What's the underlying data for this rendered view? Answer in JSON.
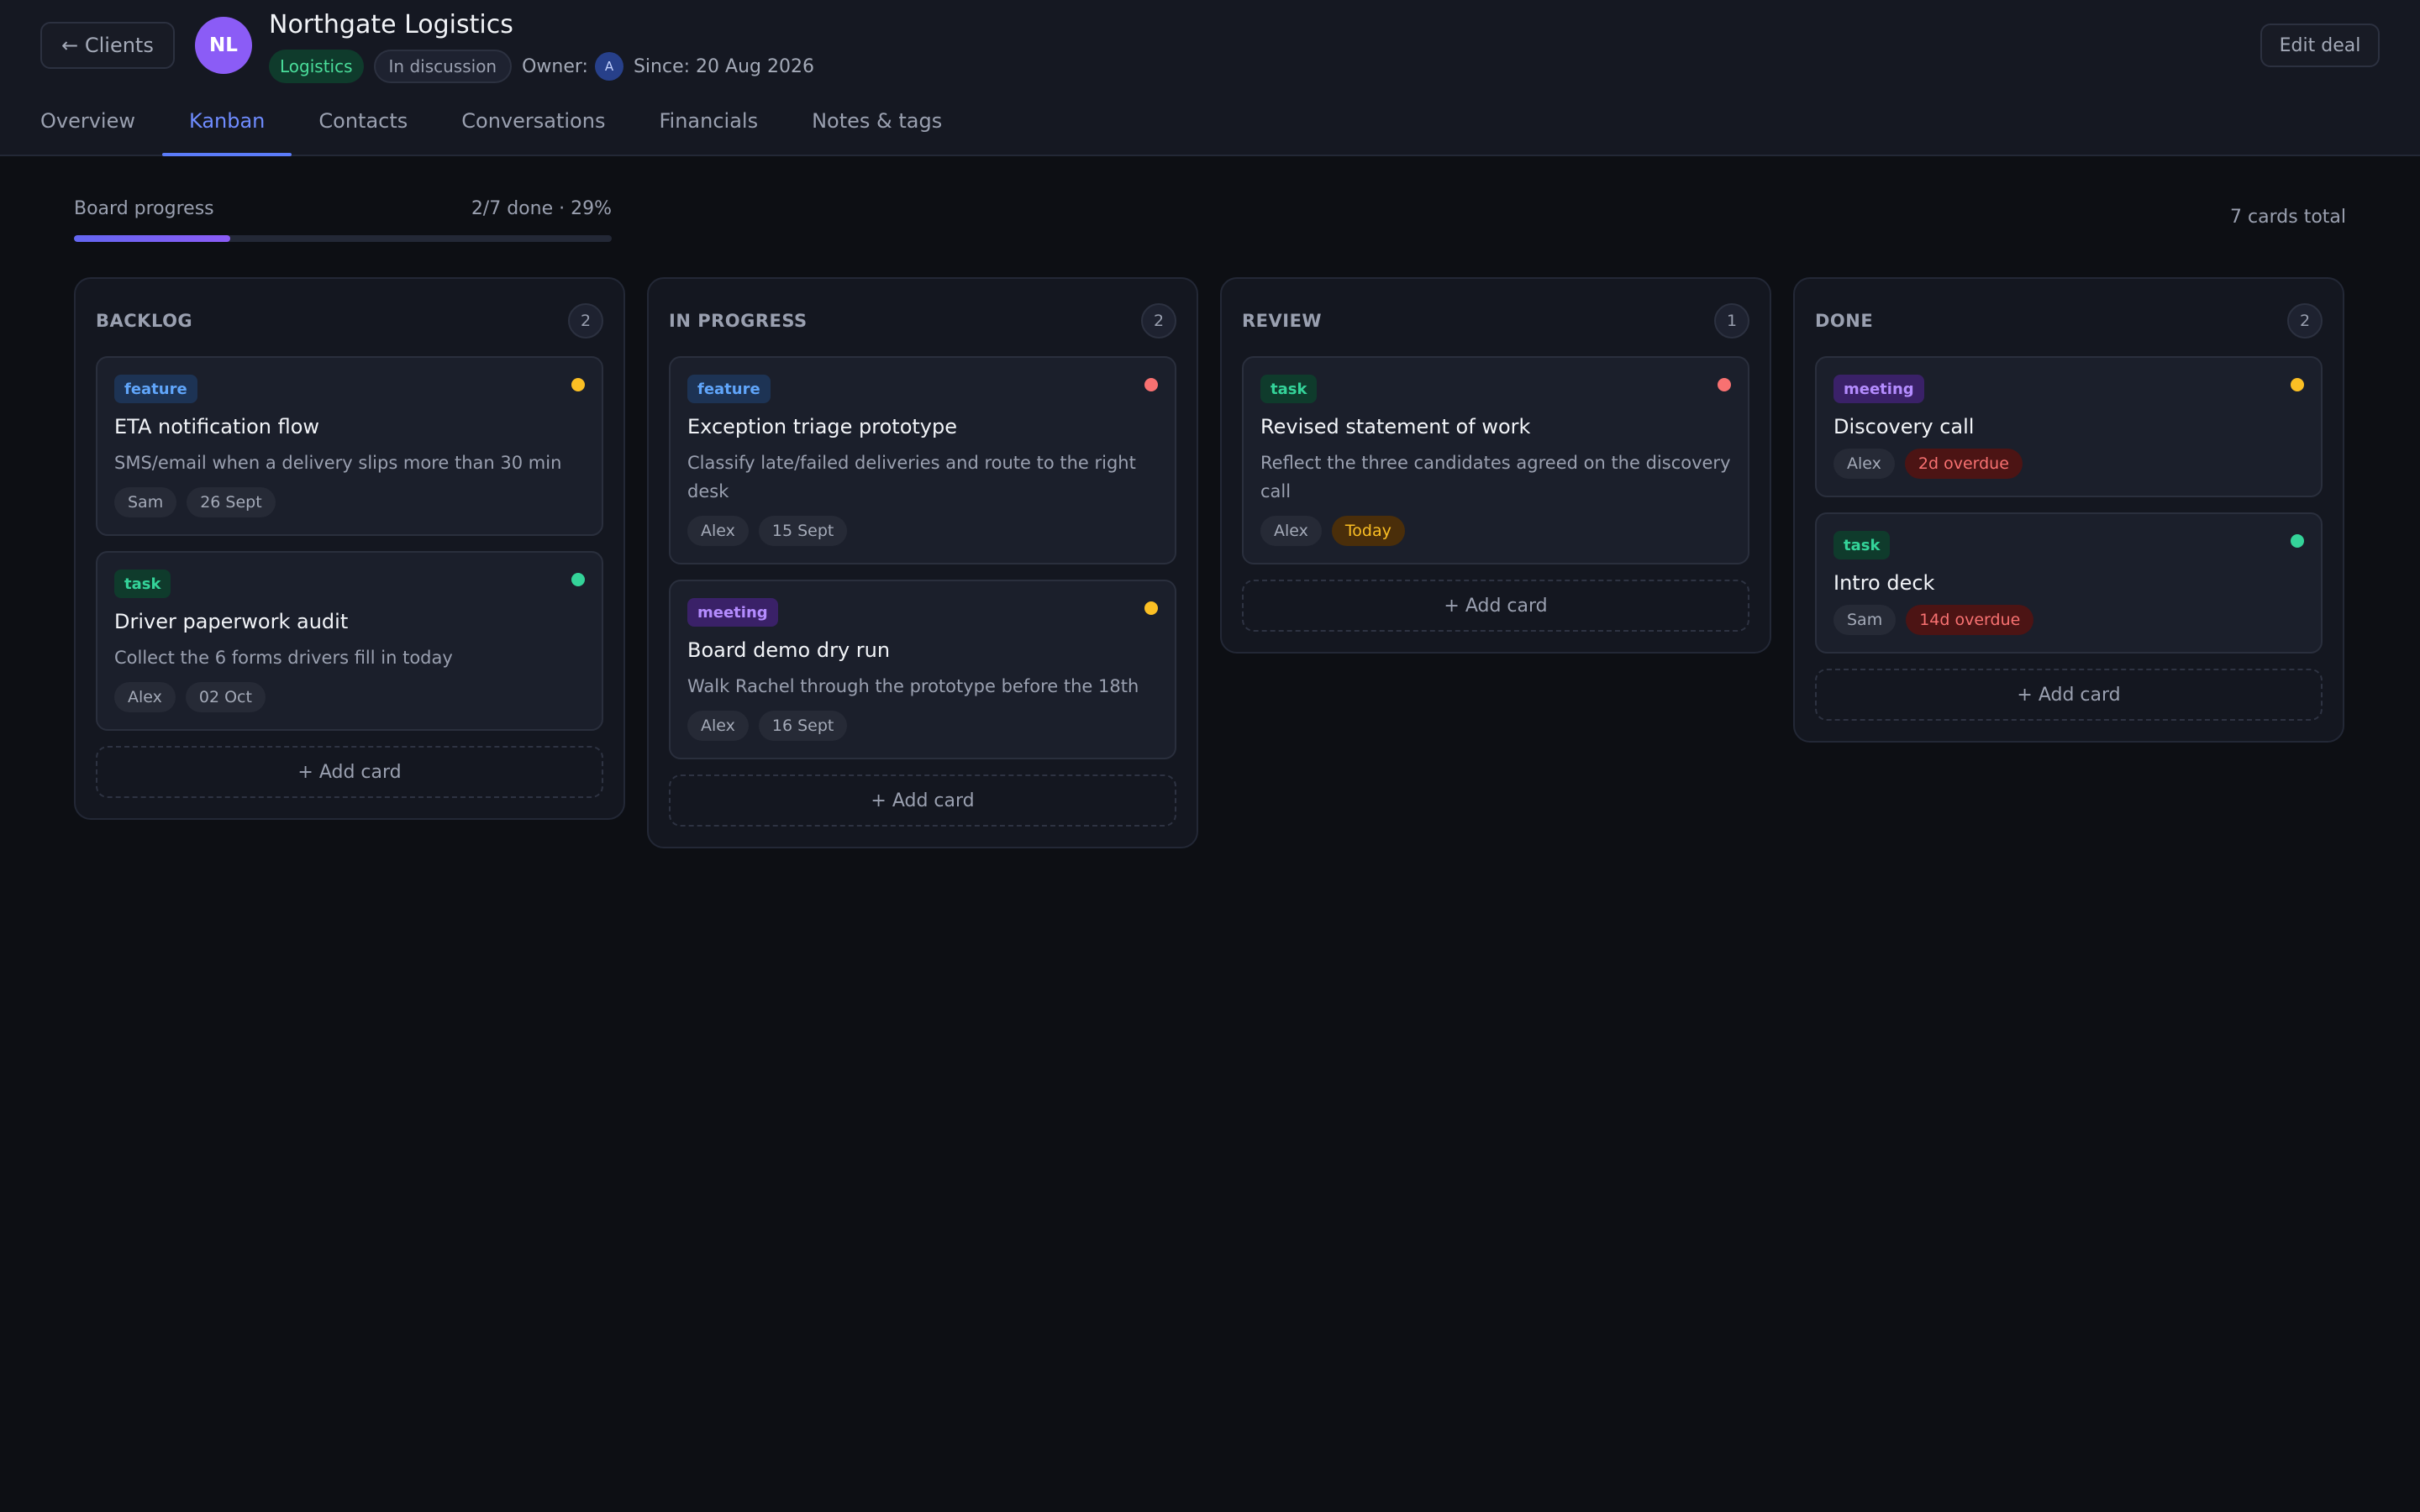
{
  "header": {
    "back_label": "← Clients",
    "avatar_initials": "NL",
    "client_name": "Northgate Logistics",
    "industry": "Logistics",
    "status": "In discussion",
    "owner_label": "Owner:",
    "owner_initial": "A",
    "since": "Since: 20 Aug 2026",
    "edit_label": "Edit deal"
  },
  "tabs": [
    {
      "label": "Overview"
    },
    {
      "label": "Kanban"
    },
    {
      "label": "Contacts"
    },
    {
      "label": "Conversations"
    },
    {
      "label": "Financials"
    },
    {
      "label": "Notes & tags"
    }
  ],
  "active_tab": "Kanban",
  "progress": {
    "label": "Board progress",
    "value_text": "2/7 done · 29%",
    "fraction": 0.29
  },
  "cards_total": "7 cards total",
  "add_card_label": "+ Add card",
  "colors": {
    "accent": "#5b7cfa",
    "priority_high": "#f87171",
    "priority_medium": "#fbbf24",
    "priority_low": "#34d399"
  },
  "columns": [
    {
      "title": "BACKLOG",
      "count": "2",
      "cards": [
        {
          "tag": "feature",
          "title": "ETA notification flow",
          "desc": "SMS/email when a delivery slips more than 30 min",
          "assignee": "Sam",
          "due": "26 Sept",
          "due_style": "normal",
          "priority": "medium"
        },
        {
          "tag": "task",
          "title": "Driver paperwork audit",
          "desc": "Collect the 6 forms drivers fill in today",
          "assignee": "Alex",
          "due": "02 Oct",
          "due_style": "normal",
          "priority": "low"
        }
      ]
    },
    {
      "title": "IN PROGRESS",
      "count": "2",
      "cards": [
        {
          "tag": "feature",
          "title": "Exception triage prototype",
          "desc": "Classify late/failed deliveries and route to the right desk",
          "assignee": "Alex",
          "due": "15 Sept",
          "due_style": "normal",
          "priority": "high"
        },
        {
          "tag": "meeting",
          "title": "Board demo dry run",
          "desc": "Walk Rachel through the prototype before the 18th",
          "assignee": "Alex",
          "due": "16 Sept",
          "due_style": "normal",
          "priority": "medium"
        }
      ]
    },
    {
      "title": "REVIEW",
      "count": "1",
      "cards": [
        {
          "tag": "task",
          "title": "Revised statement of work",
          "desc": "Reflect the three candidates agreed on the discovery call",
          "assignee": "Alex",
          "due": "Today",
          "due_style": "today",
          "priority": "high"
        }
      ]
    },
    {
      "title": "DONE",
      "count": "2",
      "cards": [
        {
          "tag": "meeting",
          "title": "Discovery call",
          "desc": "",
          "assignee": "Alex",
          "due": "2d overdue",
          "due_style": "overdue",
          "priority": "medium"
        },
        {
          "tag": "task",
          "title": "Intro deck",
          "desc": "",
          "assignee": "Sam",
          "due": "14d overdue",
          "due_style": "overdue",
          "priority": "low"
        }
      ]
    }
  ]
}
